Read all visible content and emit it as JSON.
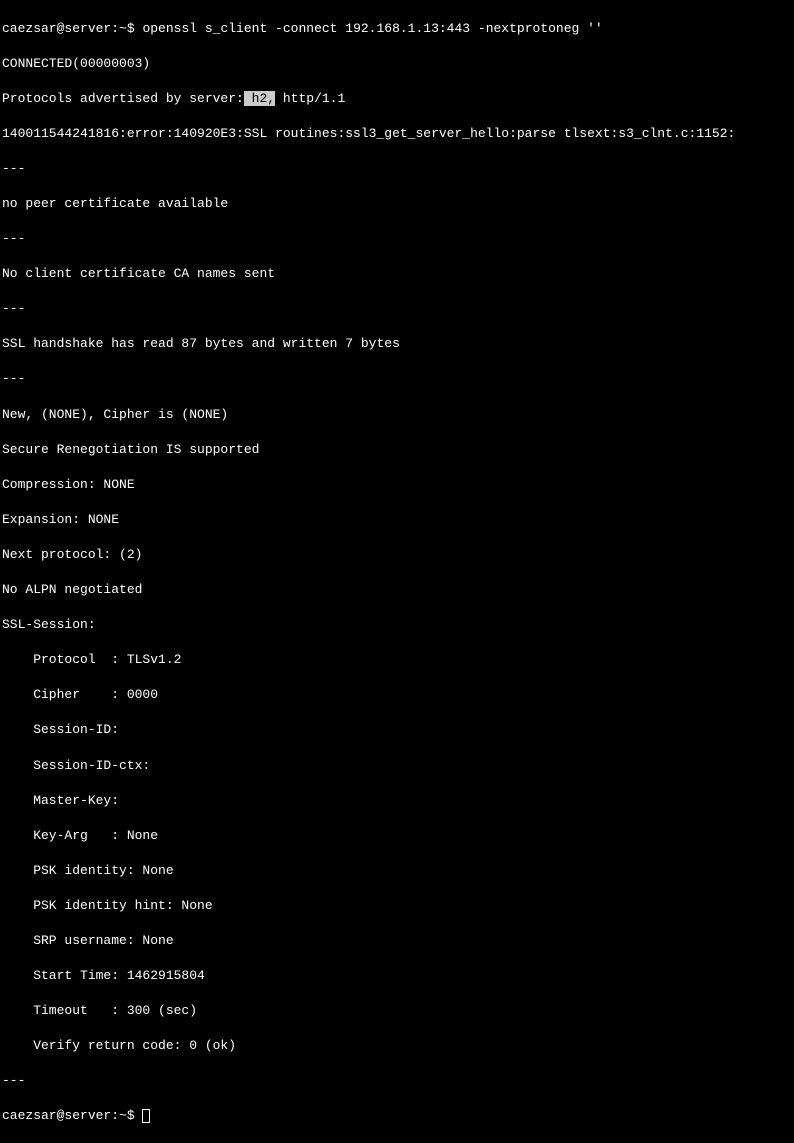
{
  "prompt1": {
    "user": "caezsar@server",
    "path": ":~$ ",
    "command": "openssl s_client -connect 192.168.1.13:443 -nextprotoneg ''"
  },
  "output": {
    "connected": "CONNECTED(00000003)",
    "protocols_prefix": "Protocols advertised by server:",
    "protocols_highlight": " h2,",
    "protocols_suffix": " http/1.1",
    "error": "140011544241816:error:140920E3:SSL routines:ssl3_get_server_hello:parse tlsext:s3_clnt.c:1152:",
    "sep1": "---",
    "no_peer": "no peer certificate available",
    "sep2": "---",
    "no_client": "No client certificate CA names sent",
    "sep3": "---",
    "handshake": "SSL handshake has read 87 bytes and written 7 bytes",
    "sep4": "---",
    "new_cipher": "New, (NONE), Cipher is (NONE)",
    "secure_reneg": "Secure Renegotiation IS supported",
    "compression": "Compression: NONE",
    "expansion": "Expansion: NONE",
    "next_proto": "Next protocol: (2)",
    "no_alpn": "No ALPN negotiated",
    "ssl_session": "SSL-Session:",
    "protocol": "    Protocol  : TLSv1.2",
    "cipher": "    Cipher    : 0000",
    "session_id": "    Session-ID:",
    "session_id_ctx": "    Session-ID-ctx:",
    "master_key": "    Master-Key:",
    "key_arg": "    Key-Arg   : None",
    "psk_identity": "    PSK identity: None",
    "psk_hint": "    PSK identity hint: None",
    "srp": "    SRP username: None",
    "start_time": "    Start Time: 1462915804",
    "timeout": "    Timeout   : 300 (sec)",
    "verify": "    Verify return code: 0 (ok)",
    "sep5": "---"
  },
  "prompt2": {
    "user": "caezsar@server",
    "path": ":~$ "
  }
}
